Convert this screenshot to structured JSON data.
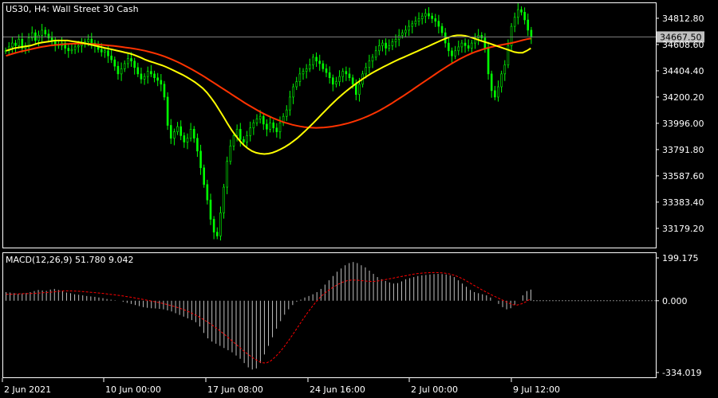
{
  "window": {
    "title": "US30, H4:  Wall Street 30 Cash"
  },
  "colors": {
    "background": "#000000",
    "frame": "#ffffff",
    "bull_candle": "#00ff00",
    "bear_candle": "#00ff00",
    "ma_fast": "#ffff00",
    "ma_slow": "#ff3300",
    "macd_hist": "#c0c0c0",
    "macd_signal": "#ff0000",
    "price_line": "#808080",
    "text": "#ffffff"
  },
  "indicator": {
    "label": "MACD(12,26,9) 51.780 9.042"
  },
  "current_price": "34667.50",
  "chart_data": [
    {
      "type": "candlestick",
      "title": "US30, H4:  Wall Street 30 Cash",
      "ylim": [
        33030,
        34930
      ],
      "y_ticks": [
        "34812.80",
        "34608.60",
        "34404.40",
        "34200.20",
        "33996.00",
        "33791.80",
        "33587.60",
        "33383.40",
        "33179.20"
      ],
      "x_ticks": [
        "2 Jun 2021",
        "10 Jun 00:00",
        "17 Jun 08:00",
        "24 Jun 16:00",
        "2 Jul 00:00",
        "9 Jul 12:00"
      ],
      "close": [
        34560,
        34590,
        34620,
        34600,
        34650,
        34580,
        34600,
        34660,
        34700,
        34640,
        34680,
        34720,
        34690,
        34660,
        34640,
        34610,
        34600,
        34620,
        34580,
        34560,
        34570,
        34590,
        34600,
        34610,
        34630,
        34650,
        34620,
        34600,
        34570,
        34550,
        34560,
        34520,
        34490,
        34440,
        34380,
        34420,
        34460,
        34500,
        34480,
        34430,
        34380,
        34340,
        34360,
        34400,
        34380,
        34350,
        34330,
        34300,
        34200,
        33980,
        33880,
        33930,
        33970,
        33900,
        33850,
        33880,
        33950,
        33880,
        33780,
        33650,
        33520,
        33400,
        33250,
        33150,
        33120,
        33300,
        33500,
        33700,
        33820,
        33900,
        33950,
        33870,
        33850,
        33900,
        33960,
        34000,
        34030,
        34050,
        33990,
        33950,
        34000,
        33960,
        33930,
        34000,
        34050,
        34100,
        34200,
        34280,
        34320,
        34380,
        34400,
        34420,
        34450,
        34510,
        34480,
        34460,
        34420,
        34390,
        34350,
        34300,
        34320,
        34360,
        34400,
        34380,
        34350,
        34300,
        34220,
        34300,
        34380,
        34430,
        34480,
        34510,
        34560,
        34600,
        34620,
        34580,
        34600,
        34630,
        34650,
        34680,
        34700,
        34720,
        34750,
        34770,
        34790,
        34810,
        34830,
        34850,
        34830,
        34810,
        34790,
        34750,
        34700,
        34620,
        34560,
        34520,
        34560,
        34590,
        34620,
        34600,
        34580,
        34620,
        34660,
        34680,
        34660,
        34580,
        34380,
        34250,
        34200,
        34280,
        34380,
        34450,
        34600,
        34750,
        34820,
        34880,
        34860,
        34800,
        34720,
        34667.5
      ],
      "ma_fast": [
        34560,
        34570,
        34580,
        34585,
        34590,
        34595,
        34600,
        34610,
        34620,
        34625,
        34630,
        34635,
        34640,
        34640,
        34640,
        34640,
        34635,
        34630,
        34625,
        34620,
        34612,
        34605,
        34598,
        34590,
        34583,
        34576,
        34569,
        34562,
        34555,
        34547,
        34540,
        34530,
        34518,
        34505,
        34490,
        34478,
        34468,
        34458,
        34447,
        34435,
        34420,
        34405,
        34390,
        34374,
        34357,
        34338,
        34317,
        34294,
        34268,
        34235,
        34195,
        34150,
        34100,
        34048,
        33995,
        33945,
        33900,
        33860,
        33826,
        33800,
        33780,
        33767,
        33760,
        33757,
        33760,
        33768,
        33780,
        33795,
        33812,
        33832,
        33855,
        33880,
        33908,
        33938,
        33969,
        34000,
        34033,
        34066,
        34099,
        34131,
        34162,
        34192,
        34220,
        34247,
        34272,
        34296,
        34319,
        34341,
        34362,
        34382,
        34400,
        34417,
        34434,
        34450,
        34466,
        34481,
        34496,
        34510,
        34524,
        34538,
        34552,
        34567,
        34581,
        34595,
        34610,
        34624,
        34639,
        34653,
        34665,
        34675,
        34680,
        34680,
        34676,
        34668,
        34658,
        34647,
        34636,
        34626,
        34616,
        34605,
        34594,
        34583,
        34572,
        34561,
        34550,
        34545,
        34545,
        34560,
        34580
      ],
      "ma_slow": [
        34520,
        34530,
        34540,
        34548,
        34556,
        34563,
        34570,
        34577,
        34584,
        34590,
        34595,
        34600,
        34604,
        34607,
        34610,
        34612,
        34614,
        34615,
        34616,
        34616,
        34615,
        34614,
        34612,
        34610,
        34607,
        34604,
        34601,
        34598,
        34594,
        34590,
        34586,
        34582,
        34577,
        34572,
        34566,
        34560,
        34552,
        34544,
        34535,
        34525,
        34514,
        34502,
        34489,
        34475,
        34460,
        34444,
        34428,
        34411,
        34393,
        34375,
        34356,
        34336,
        34316,
        34296,
        34276,
        34256,
        34236,
        34216,
        34196,
        34176,
        34156,
        34137,
        34119,
        34101,
        34084,
        34068,
        34053,
        34039,
        34026,
        34014,
        34003,
        33994,
        33985,
        33978,
        33972,
        33967,
        33964,
        33962,
        33961,
        33962,
        33964,
        33967,
        33971,
        33976,
        33982,
        33989,
        33997,
        34006,
        34016,
        34027,
        34039,
        34052,
        34066,
        34081,
        34097,
        34114,
        34132,
        34151,
        34171,
        34191,
        34211,
        34232,
        34253,
        34274,
        34295,
        34316,
        34337,
        34358,
        34379,
        34400,
        34420,
        34440,
        34459,
        34477,
        34494,
        34510,
        34525,
        34539,
        34551,
        34562,
        34572,
        34581,
        34589,
        34596,
        34602,
        34608,
        34614,
        34620,
        34627,
        34635,
        34643,
        34650,
        34655
      ],
      "series": [
        {
          "name": "",
          "values": []
        }
      ]
    },
    {
      "type": "bar",
      "title": "MACD(12,26,9) 51.780 9.042",
      "ylim": [
        -334.019,
        199.175
      ],
      "y_ticks": [
        "199.175",
        "0.000",
        "-334.019"
      ],
      "macd": [
        40,
        38,
        35,
        32,
        34,
        36,
        40,
        45,
        50,
        48,
        46,
        52,
        55,
        50,
        44,
        38,
        35,
        30,
        28,
        25,
        22,
        20,
        18,
        15,
        12,
        8,
        5,
        2,
        0,
        -5,
        -10,
        -15,
        -20,
        -25,
        -30,
        -33,
        -35,
        -36,
        -38,
        -40,
        -45,
        -50,
        -58,
        -66,
        -74,
        -82,
        -90,
        -100,
        -120,
        -150,
        -175,
        -190,
        -200,
        -210,
        -220,
        -230,
        -240,
        -255,
        -270,
        -290,
        -310,
        -320,
        -315,
        -290,
        -250,
        -210,
        -170,
        -130,
        -95,
        -65,
        -40,
        -20,
        -5,
        5,
        15,
        22,
        30,
        40,
        55,
        75,
        95,
        115,
        135,
        150,
        165,
        175,
        180,
        175,
        165,
        155,
        140,
        125,
        110,
        100,
        92,
        85,
        80,
        82,
        90,
        100,
        105,
        110,
        115,
        118,
        120,
        122,
        124,
        125,
        124,
        122,
        118,
        110,
        95,
        80,
        65,
        50,
        40,
        35,
        30,
        25,
        15,
        0,
        -15,
        -30,
        -40,
        -35,
        -20,
        0,
        25,
        45,
        51.78
      ],
      "signal": [
        30,
        30,
        31,
        32,
        33,
        33,
        34,
        35,
        37,
        38,
        40,
        42,
        44,
        46,
        46,
        45,
        44,
        43,
        41,
        39,
        37,
        35,
        33,
        30,
        28,
        25,
        22,
        19,
        16,
        12,
        8,
        4,
        0,
        -4,
        -8,
        -13,
        -18,
        -24,
        -30,
        -37,
        -45,
        -54,
        -64,
        -75,
        -87,
        -100,
        -114,
        -129,
        -145,
        -162,
        -180,
        -198,
        -216,
        -234,
        -250,
        -265,
        -278,
        -288,
        -290,
        -280,
        -262,
        -240,
        -214,
        -185,
        -155,
        -124,
        -93,
        -62,
        -34,
        -8,
        15,
        34,
        50,
        64,
        76,
        86,
        93,
        96,
        96,
        94,
        92,
        90,
        90,
        92,
        96,
        100,
        104,
        108,
        112,
        116,
        120,
        124,
        127,
        129,
        130,
        131,
        131,
        130,
        128,
        124,
        118,
        110,
        100,
        88,
        76,
        64,
        52,
        41,
        30,
        20,
        10,
        0,
        -10,
        -18,
        -20,
        -14,
        -4,
        9.042
      ]
    }
  ]
}
